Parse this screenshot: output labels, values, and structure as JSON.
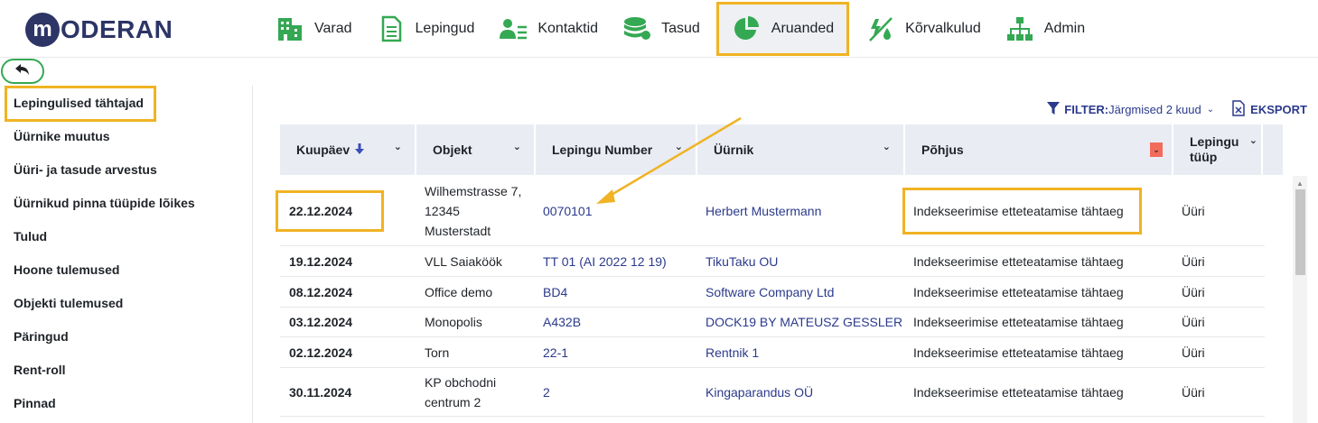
{
  "brand": {
    "logo_initial": "m",
    "logo_text": "ODERAN"
  },
  "nav": [
    {
      "label": "Varad",
      "icon": "buildings-icon"
    },
    {
      "label": "Lepingud",
      "icon": "document-icon"
    },
    {
      "label": "Kontaktid",
      "icon": "contacts-icon"
    },
    {
      "label": "Tasud",
      "icon": "coins-icon"
    },
    {
      "label": "Aruanded",
      "icon": "pie-chart-icon",
      "active": true
    },
    {
      "label": "Kõrvalkulud",
      "icon": "utilities-icon"
    },
    {
      "label": "Admin",
      "icon": "org-chart-icon"
    }
  ],
  "sidebar": {
    "items": [
      "Lepingulised tähtajad",
      "Üürnike muutus",
      "Üüri- ja tasude arvestus",
      "Üürnikud pinna tüüpide lõikes",
      "Tulud",
      "Hoone tulemused",
      "Objekti tulemused",
      "Päringud",
      "Rent-roll",
      "Pinnad"
    ]
  },
  "toolbar": {
    "filter_label": "FILTER:",
    "filter_value": "Järgmised 2 kuud",
    "export_label": "EKSPORT"
  },
  "table": {
    "columns": [
      "Kuupäev",
      "Objekt",
      "Lepingu Number",
      "Üürnik",
      "Põhjus",
      "Lepingu",
      "tüüp"
    ],
    "rows": [
      {
        "date": "22.12.2024",
        "object": [
          "Wilhemstrasse 7,",
          "12345",
          "Musterstadt"
        ],
        "contract": "0070101",
        "tenant": "Herbert Mustermann",
        "reason": "Indekseerimise etteteatamise tähtaeg",
        "type": "Üüri"
      },
      {
        "date": "19.12.2024",
        "object": [
          "VLL Saiaköök"
        ],
        "contract": "TT 01 (AI 2022 12 19)",
        "tenant": "TikuTaku OU",
        "reason": "Indekseerimise etteteatamise tähtaeg",
        "type": "Üüri"
      },
      {
        "date": "08.12.2024",
        "object": [
          "Office demo"
        ],
        "contract": "BD4",
        "tenant": "Software Company Ltd",
        "reason": "Indekseerimise etteteatamise tähtaeg",
        "type": "Üüri"
      },
      {
        "date": "03.12.2024",
        "object": [
          "Monopolis"
        ],
        "contract": "A432B",
        "tenant": "DOCK19 BY MATEUSZ GESSLER",
        "reason": "Indekseerimise etteteatamise tähtaeg",
        "type": "Üüri"
      },
      {
        "date": "02.12.2024",
        "object": [
          "Torn"
        ],
        "contract": "22-1",
        "tenant": "Rentnik 1",
        "reason": "Indekseerimise etteteatamise tähtaeg",
        "type": "Üüri"
      },
      {
        "date": "30.11.2024",
        "object": [
          "KP obchodni",
          "centrum 2"
        ],
        "contract": "2",
        "tenant": "Kingaparandus OÜ",
        "reason": "Indekseerimise etteteatamise tähtaeg",
        "type": "Üüri"
      }
    ]
  },
  "colors": {
    "accent": "#f0b323",
    "brand": "#2c3566",
    "link": "#2b3a8c",
    "icon_green": "#34a853",
    "sort_arrow": "#3b4db8",
    "filter_red": "#f26b5b"
  }
}
